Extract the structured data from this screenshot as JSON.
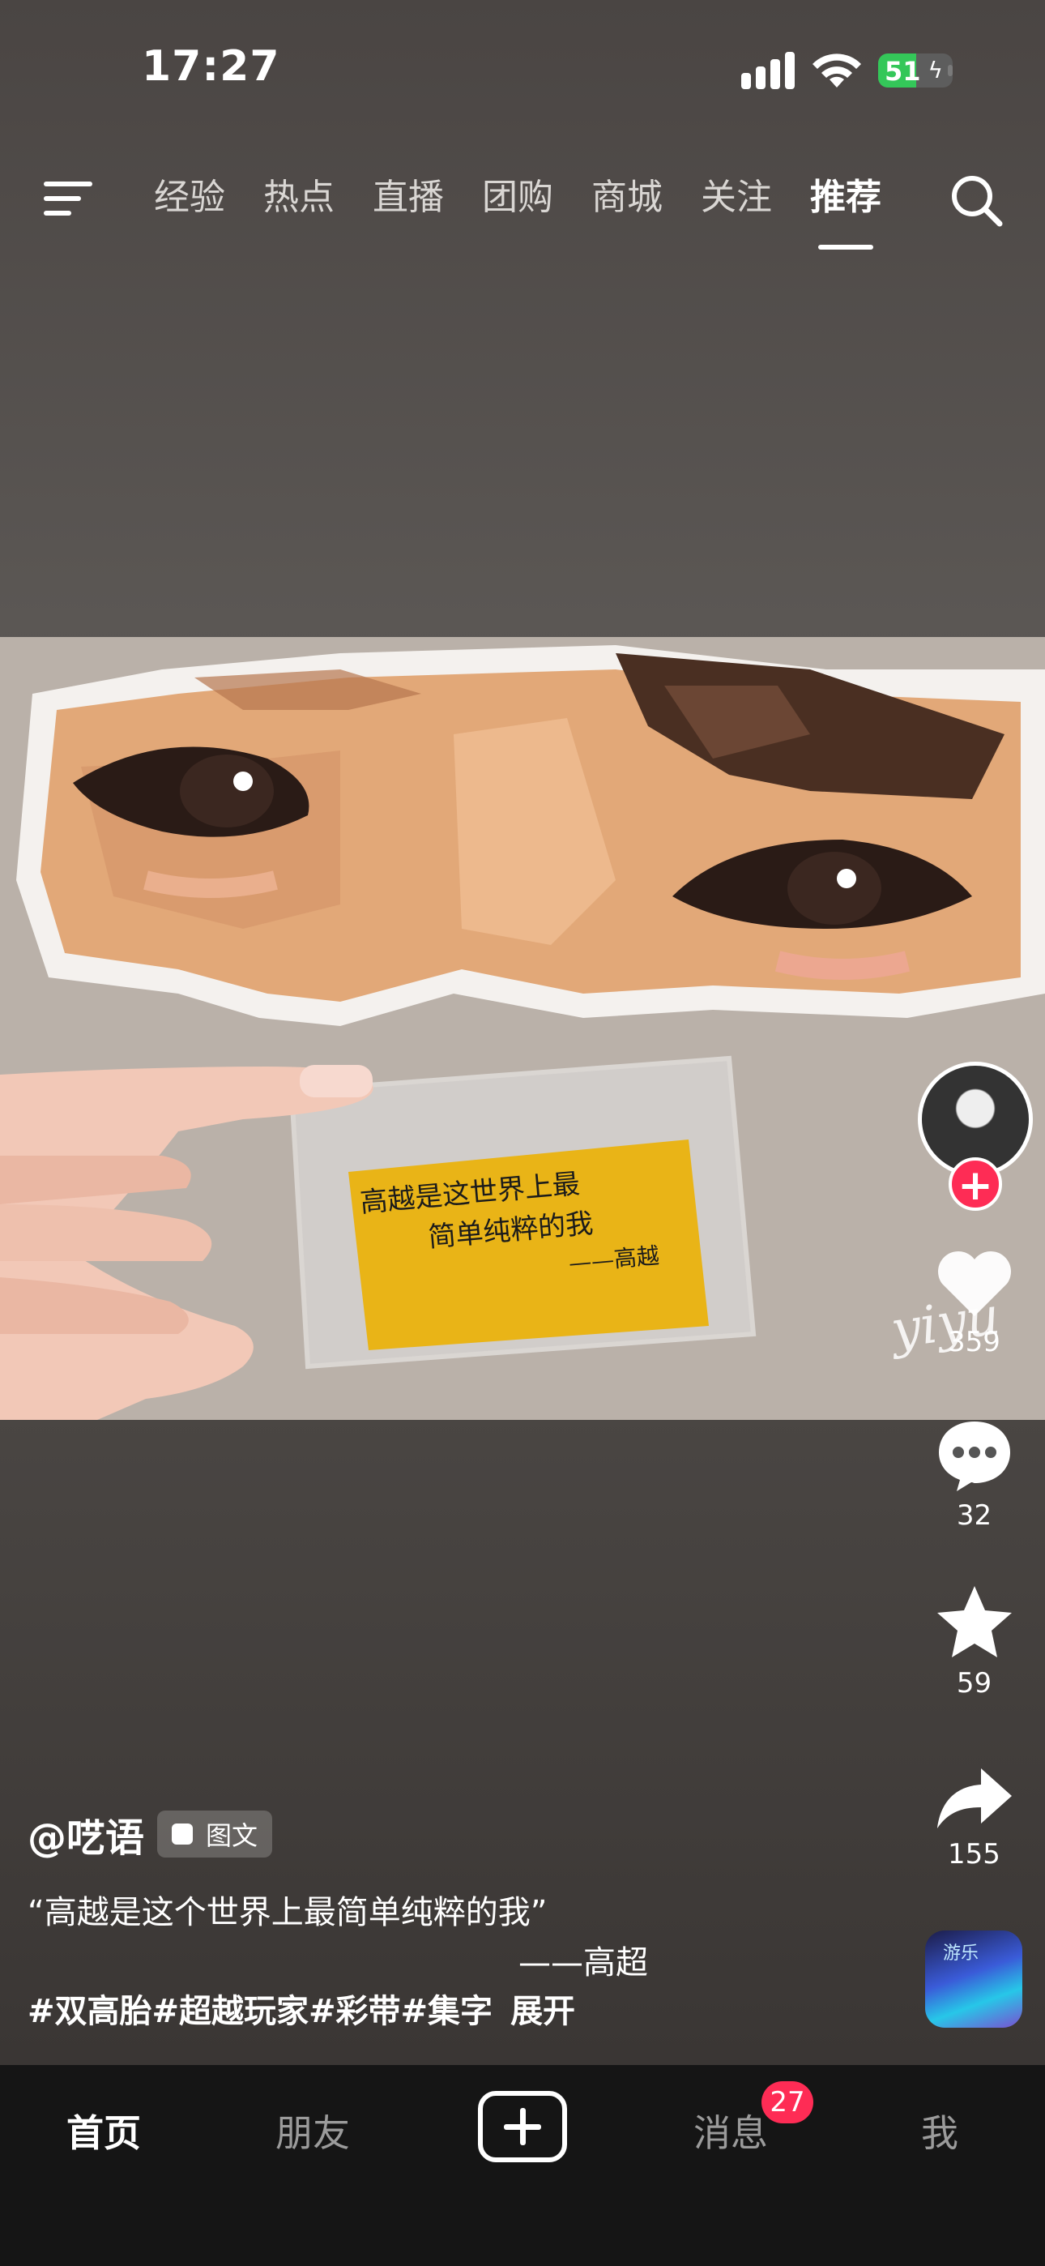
{
  "status_bar": {
    "time": "17:27",
    "battery": "51",
    "battery_level": 0.51
  },
  "top_nav": {
    "tabs": [
      "经验",
      "热点",
      "直播",
      "团购",
      "商城",
      "关注",
      "推荐"
    ],
    "active_tab": "推荐"
  },
  "media": {
    "card_lines": [
      "高越是这世界上最",
      "简单纯粹的我",
      "——高越"
    ],
    "watermark": "yiyu"
  },
  "rail": {
    "likes": "359",
    "comments": "32",
    "favorites": "59",
    "shares": "155",
    "music_label": "游乐"
  },
  "post": {
    "author": "@呓语",
    "type_badge": "图文",
    "quote": "“高越是这个世界上最简单纯粹的我”",
    "quote_sign": "——高超",
    "hashtags": "#双高胎#超越玩家#彩带#集字",
    "expand": "展开"
  },
  "bottom_nav": {
    "home": "首页",
    "friends": "朋友",
    "messages": "消息",
    "messages_badge": "27",
    "me": "我"
  }
}
